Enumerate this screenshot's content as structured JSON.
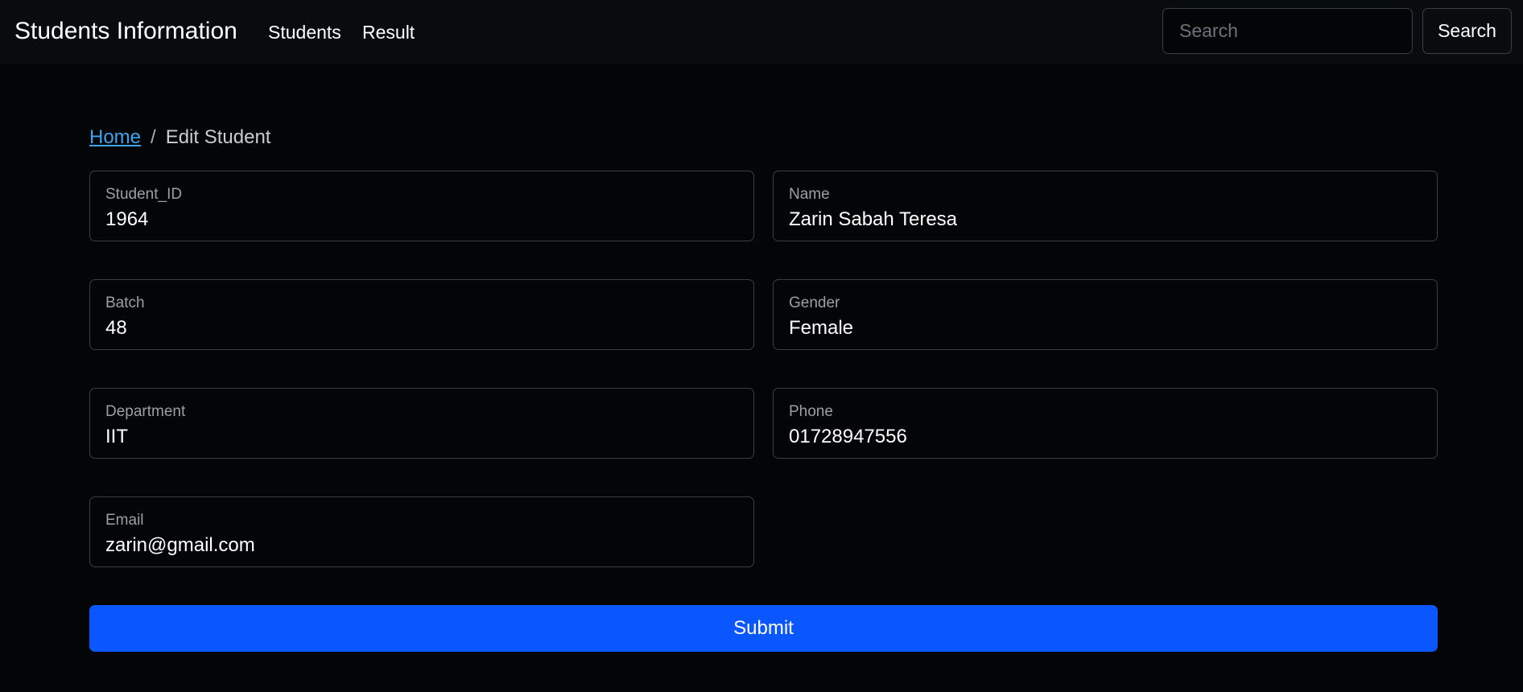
{
  "navbar": {
    "brand": "Students Information",
    "links": [
      {
        "label": "Students"
      },
      {
        "label": "Result"
      }
    ],
    "search": {
      "placeholder": "Search",
      "value": "",
      "button_label": "Search"
    }
  },
  "breadcrumb": {
    "home": "Home",
    "separator": "/",
    "current": "Edit Student"
  },
  "form": {
    "fields": [
      {
        "label": "Student_ID",
        "value": "1964"
      },
      {
        "label": "Name",
        "value": "Zarin Sabah Teresa"
      },
      {
        "label": "Batch",
        "value": "48"
      },
      {
        "label": "Gender",
        "value": "Female"
      },
      {
        "label": "Department",
        "value": "IIT"
      },
      {
        "label": "Phone",
        "value": "01728947556"
      },
      {
        "label": "Email",
        "value": "zarin@gmail.com"
      }
    ],
    "submit_label": "Submit"
  },
  "colors": {
    "background": "#030507",
    "navbar": "#080c0f",
    "link": "#3fa4ee",
    "primary": "#0b57ff",
    "border": "#3a3f44"
  }
}
